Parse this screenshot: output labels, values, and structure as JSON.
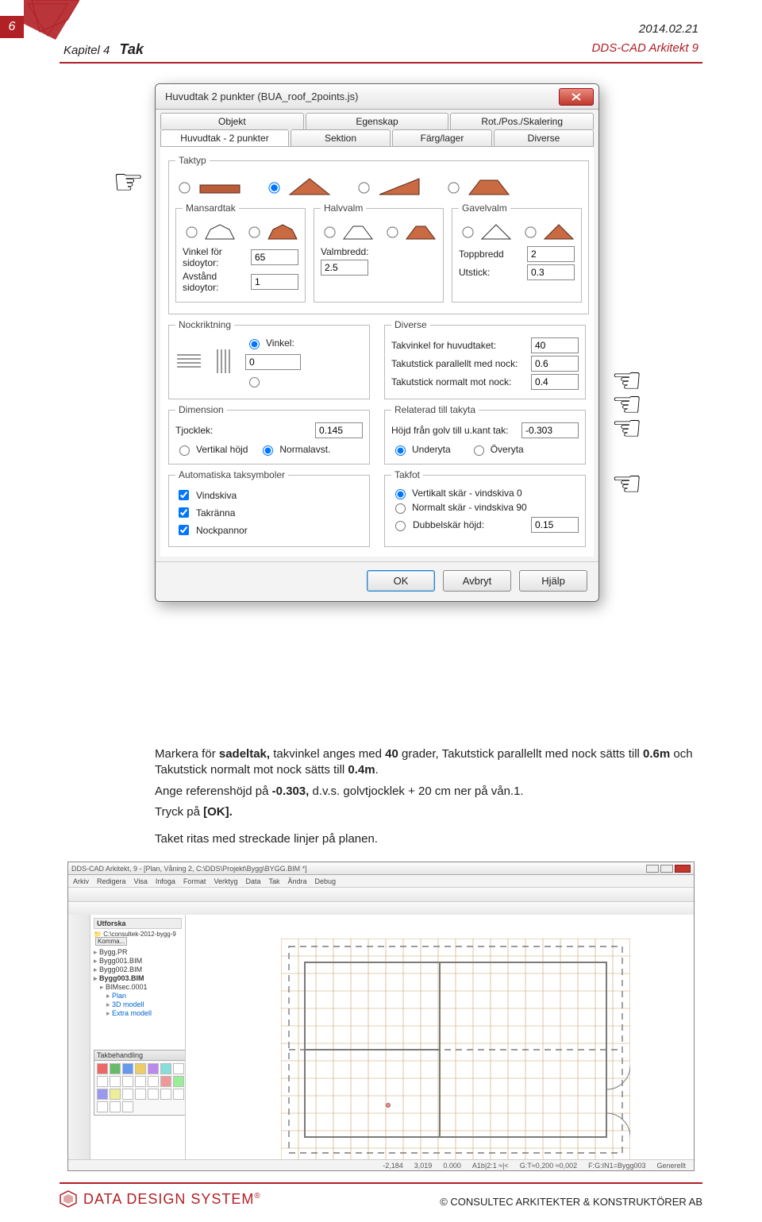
{
  "page": {
    "number": "6",
    "date": "2014.02.21",
    "chapter_label": "Kapitel 4",
    "chapter_title": "Tak",
    "product": "DDS-CAD Arkitekt 9",
    "footer_company": "DATA DESIGN SYSTEM",
    "footer_mark": "®",
    "footer_copyright": "© CONSULTEC ARKITEKTER & KONSTRUKTÖRER AB"
  },
  "dialog": {
    "title": "Huvudtak 2 punkter (BUA_roof_2points.js)",
    "tabs_row1": [
      "Objekt",
      "Egenskap",
      "Rot./Pos./Skalering"
    ],
    "tabs_row2": [
      "Huvudtak - 2 punkter",
      "Sektion",
      "Färg/lager",
      "Diverse"
    ],
    "group_taktyp": "Taktyp",
    "sub_mansard": "Mansardtak",
    "sub_halvvalm": "Halvvalm",
    "sub_gavel": "Gavelvalm",
    "field_vinkel_sidoytor": "Vinkel för sidoytor:",
    "val_vinkel_sidoytor": "65",
    "field_valmbredd": "Valmbredd:",
    "val_valmbredd": "2.5",
    "field_toppbredd": "Toppbredd",
    "val_toppbredd": "2",
    "field_avstand_sidoytor": "Avstånd sidoytor:",
    "val_avstand_sidoytor": "1",
    "field_utstick": "Utstick:",
    "val_utstick": "0.3",
    "group_nock": "Nockriktning",
    "field_vinkel": "Vinkel:",
    "val_nock_vinkel": "0",
    "group_diverse": "Diverse",
    "field_takvinkel": "Takvinkel for huvudtaket:",
    "val_takvinkel": "40",
    "field_takutstick_nock": "Takutstick parallellt med nock:",
    "val_takutstick_nock": "0.6",
    "field_takutstick_normalt": "Takutstick normalt mot nock:",
    "val_takutstick_normalt": "0.4",
    "group_dimension": "Dimension",
    "field_tjocklek": "Tjocklek:",
    "val_tjocklek": "0.145",
    "group_relaterad": "Relaterad till takyta",
    "field_hojd": "Höjd från golv till u.kant tak:",
    "val_hojd": "-0.303",
    "radio_vertikal": "Vertikal höjd",
    "radio_normal": "Normalavst.",
    "radio_underyta": "Underyta",
    "radio_overyta": "Överyta",
    "group_autotak": "Automatiska taksymboler",
    "chk_vindskiva": "Vindskiva",
    "chk_takranna": "Takränna",
    "chk_nockpannor": "Nockpannor",
    "group_takfot": "Takfot",
    "radio_vertikalt_skar": "Vertikalt skär - vindskiva 0",
    "radio_normalt_skar": "Normalt skär - vindskiva 90",
    "field_dubbelskar": "Dubbelskär höjd:",
    "val_dubbelskar": "0.15",
    "btn_ok": "OK",
    "btn_cancel": "Avbryt",
    "btn_help": "Hjälp"
  },
  "body": {
    "para1a": "Markera för ",
    "para1b": "sadeltak,",
    "para1c": " takvinkel anges med ",
    "para1d": "40",
    "para1e": " grader, Takutstick parallellt med nock sätts till ",
    "para1f": "0.6m",
    "para1g": " och Takutstick normalt mot nock sätts till ",
    "para1h": "0.4m",
    "para1i": ".",
    "para2a": "Ange referenshöjd på ",
    "para2b": "-0.303,",
    "para2c": " d.v.s. golvtjocklek + 20 cm ner på vån.1.",
    "para3a": "Tryck på ",
    "para3b": "[OK].",
    "para4": "Taket ritas med streckade linjer på planen."
  },
  "lower": {
    "title": "DDS-CAD Arkitekt, 9 - [Plan, Våning 2, C:\\DDS\\Projekt\\Bygg\\BYGG.BIM *]",
    "menu": [
      "Arkiv",
      "Redigera",
      "Visa",
      "Infoga",
      "Format",
      "Verktyg",
      "Data",
      "Tak",
      "Ändra",
      "Debug"
    ],
    "sidebar_tab": "Utforska",
    "sidebar_path": "C:\\consultek-2012-bygg-9",
    "sidebar_btn": "Komma...",
    "tree": [
      "Bygg.PR",
      "Bygg001.BIM",
      "Bygg002.BIM",
      "Bygg003.BIM",
      "BIMsec.0001",
      "Plan",
      "3D modell",
      "Extra modell"
    ],
    "panel_title": "Takbehandling",
    "status": [
      "-2,184",
      "3,019",
      "0.000",
      "A1b|2:1 ≈|<",
      "G:T≈0,200 ≈0,002",
      "F:G:IN1=Bygg003",
      "Generellt"
    ]
  }
}
